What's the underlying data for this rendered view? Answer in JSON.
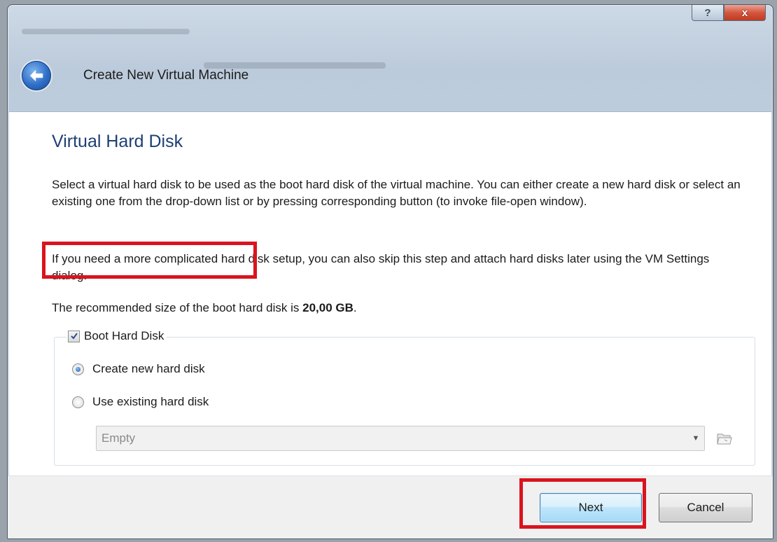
{
  "window": {
    "title": "Create New Virtual Machine",
    "help_label": "?",
    "close_label": "x"
  },
  "page": {
    "heading": "Virtual Hard Disk",
    "paragraph1": "Select a virtual hard disk to be used as the boot hard disk of the virtual machine. You can either create a new hard disk or select an existing one from the drop-down list or by pressing corresponding button (to invoke file-open window).",
    "paragraph2": "If you need a more complicated hard disk setup, you can also skip this step and attach hard disks later using the VM Settings dialog.",
    "recommended_prefix": "The recommended size of the boot hard disk is ",
    "recommended_size": "20,00 GB",
    "recommended_suffix": "."
  },
  "boot_group": {
    "label": "Boot Hard Disk",
    "checked": true,
    "options": [
      {
        "label": "Create new hard disk",
        "selected": true
      },
      {
        "label": "Use existing hard disk",
        "selected": false
      }
    ],
    "combo_value": "Empty"
  },
  "footer": {
    "next_label": "Next",
    "cancel_label": "Cancel"
  },
  "colors": {
    "highlight": "#d9141e",
    "heading": "#1e3f73"
  }
}
